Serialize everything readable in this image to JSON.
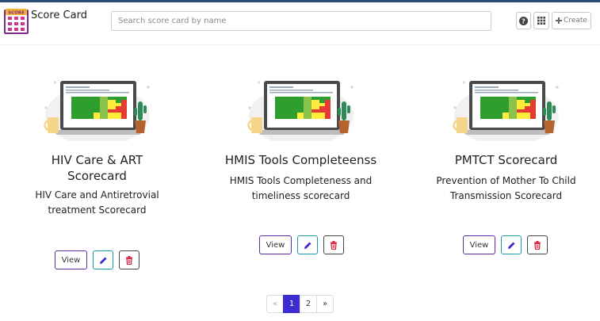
{
  "header": {
    "logo_text": "SCORE",
    "app_title": "Score Card",
    "search_placeholder": "Search score card by name",
    "help_label": "?",
    "create_label": "Create"
  },
  "colors": {
    "brand_bar": "#2c4a7a",
    "view_border": "#5a2ca8",
    "edit_accent": "#1e9aa6",
    "delete_accent": "#d9243a",
    "active_page": "#3b2bd0"
  },
  "cards": [
    {
      "name": "HIV Care & ART Scorecard",
      "name_line1": "HIV Care & ART",
      "name_line2": "Scorecard",
      "description_line1": "HIV Care and Antiretrovial",
      "description_line2": "treatment Scorecard",
      "view_label": "View"
    },
    {
      "name": "HMIS Tools Completeenss",
      "description_line1": "HMIS Tools Completeness and",
      "description_line2": "timeliness scorecard",
      "view_label": "View"
    },
    {
      "name": "PMTCT Scorecard",
      "description_line1": "Prevention of Mother To Child",
      "description_line2": "Transmission Scorecard",
      "view_label": "View"
    }
  ],
  "icons": {
    "edit": "pencil-icon",
    "delete": "trash-icon",
    "grid": "apps-grid-icon",
    "create": "plus-icon"
  },
  "pagination": {
    "prev": "«",
    "pages": [
      "1",
      "2"
    ],
    "active_page": "1",
    "next": "»"
  }
}
